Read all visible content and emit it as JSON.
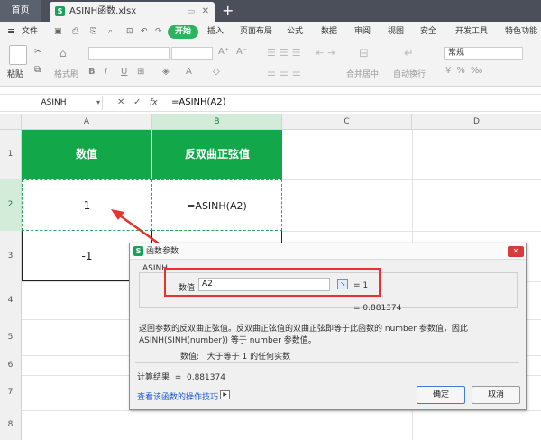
{
  "tabs": {
    "home": "首页",
    "file": "ASINH函数.xlsx",
    "add": "+"
  },
  "menu": {
    "file": "文件",
    "start": "开始",
    "insert": "插入",
    "page_layout": "页面布局",
    "formula": "公式",
    "data": "数据",
    "review": "审阅",
    "view": "视图",
    "security": "安全",
    "developer": "开发工具",
    "special": "特色功能"
  },
  "toolbar": {
    "paste": "粘贴",
    "format_painter": "格式刷",
    "merge_center": "合并居中",
    "auto_wrap": "自动换行",
    "number_format": "常规"
  },
  "formula_bar": {
    "name_box": "ASINH",
    "fx": "fx",
    "formula": "=ASINH(A2)"
  },
  "columns": [
    "A",
    "B",
    "C",
    "D"
  ],
  "rows": [
    "1",
    "2",
    "3",
    "4",
    "5",
    "6",
    "7",
    "8"
  ],
  "cells": {
    "a1": "数值",
    "b1": "反双曲正弦值",
    "a2": "1",
    "b2": "=ASINH(A2)",
    "a3": "-1"
  },
  "dialog": {
    "icon": "S",
    "title": "函数参数",
    "func_name": "ASINH",
    "arg_label": "数值",
    "arg_value": "A2",
    "arg_result": "= 1",
    "result_line": "= 0.881374",
    "desc_line1": "返回参数的反双曲正弦值。反双曲正弦值的双曲正弦即等于此函数的 number 参数值，因此",
    "desc_line2": "ASINH(SINH(number)) 等于 number 参数值。",
    "param_desc": "数值:   大于等于 1 的任何实数",
    "calc_result": "计算结果  =  0.881374",
    "help_link": "查看该函数的操作技巧",
    "ok": "确定",
    "cancel": "取消"
  },
  "colors": {
    "green_header": "#12a84a",
    "highlight_red": "#e8322f",
    "tab_bar": "#4a4f5a"
  }
}
